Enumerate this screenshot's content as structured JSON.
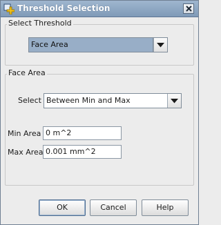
{
  "window": {
    "title": "Threshold Selection",
    "icons": {
      "app": "threshold-plus-icon",
      "close": "close-icon"
    }
  },
  "select_threshold": {
    "legend": "Select Threshold",
    "dropdown_value": "Face Area"
  },
  "face_area": {
    "legend": "Face Area",
    "select_label": "Select",
    "select_value": "Between Min and Max",
    "min_label": "Min Area",
    "min_value": "0 m^2",
    "max_label": "Max Area",
    "max_value": "0.001 mm^2"
  },
  "buttons": {
    "ok": "OK",
    "cancel": "Cancel",
    "help": "Help"
  },
  "colors": {
    "title_bar": "#8aa4c2",
    "dropdown_selected": "#98aec7",
    "app_icon_plus": "#f1c21b"
  }
}
